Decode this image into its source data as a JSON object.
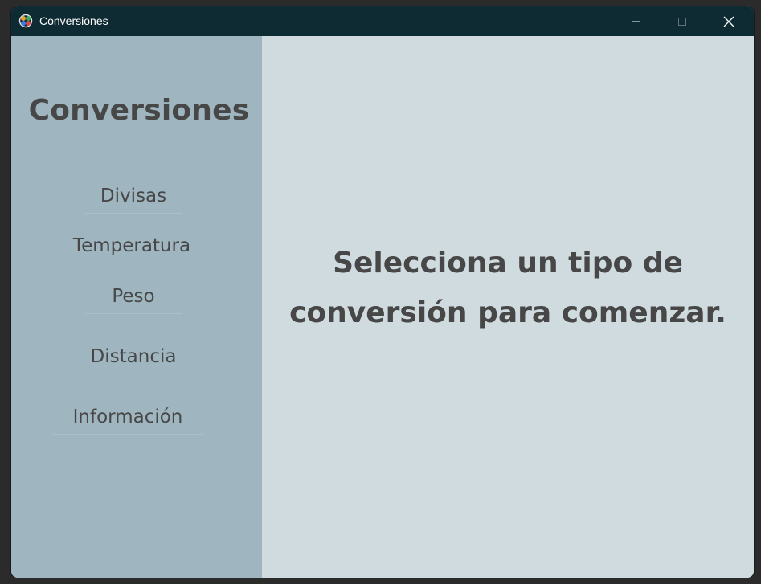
{
  "window": {
    "title": "Conversiones",
    "controls": {
      "minimize_icon": "minimize-icon",
      "maximize_icon": "maximize-icon",
      "close_icon": "close-icon"
    }
  },
  "sidebar": {
    "title": "Conversiones",
    "items": [
      {
        "label": "Divisas"
      },
      {
        "label": "Temperatura"
      },
      {
        "label": "Peso"
      },
      {
        "label": "Distancia"
      },
      {
        "label": "Información"
      }
    ]
  },
  "main": {
    "prompt_line1": "Selecciona un tipo de",
    "prompt_line2": "conversión para comenzar."
  },
  "colors": {
    "titlebar": "#0e2a33",
    "sidebar": "#9fb5bf",
    "main": "#d0dbe0",
    "text": "#474747"
  }
}
